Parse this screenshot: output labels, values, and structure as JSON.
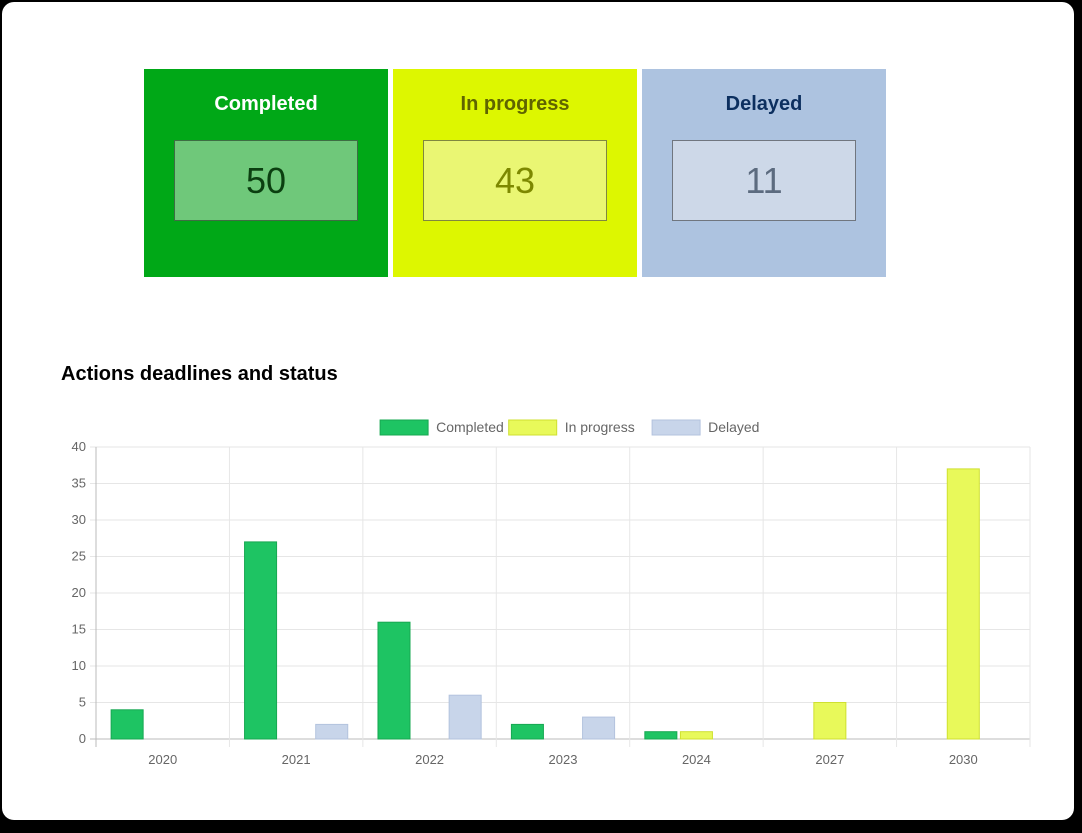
{
  "cards": [
    {
      "title": "Completed",
      "value": "50",
      "bg": "#00a817",
      "title_color": "#ffffff",
      "box_bg": "#6fc87a",
      "value_color": "#0b3f10"
    },
    {
      "title": "In progress",
      "value": "43",
      "bg": "#ddf700",
      "title_color": "#5f6400",
      "box_bg": "#eaf673",
      "value_color": "#7d8800"
    },
    {
      "title": "Delayed",
      "value": "11",
      "bg": "#adc3e0",
      "title_color": "#0c2f5f",
      "box_bg": "#cdd8e8",
      "value_color": "#5c6b7f"
    }
  ],
  "chart_title": "Actions deadlines and status",
  "chart_data": {
    "type": "bar",
    "categories": [
      "2020",
      "2021",
      "2022",
      "2023",
      "2024",
      "2027",
      "2030"
    ],
    "series": [
      {
        "name": "Completed",
        "values": [
          4,
          27,
          16,
          2,
          1,
          0,
          0
        ],
        "color": "#1ec463",
        "border": "#17a852"
      },
      {
        "name": "In progress",
        "values": [
          0,
          0,
          0,
          0,
          1,
          5,
          37
        ],
        "color": "#e8f95a",
        "border": "#cfe030"
      },
      {
        "name": "Delayed",
        "values": [
          0,
          2,
          6,
          3,
          0,
          0,
          0
        ],
        "color": "#c8d5ea",
        "border": "#b3c3de"
      }
    ],
    "ylim": [
      0,
      40
    ],
    "yticks": [
      "0",
      "5",
      "10",
      "15",
      "20",
      "25",
      "30",
      "35",
      "40"
    ],
    "grid": true,
    "legend": "top-center"
  }
}
